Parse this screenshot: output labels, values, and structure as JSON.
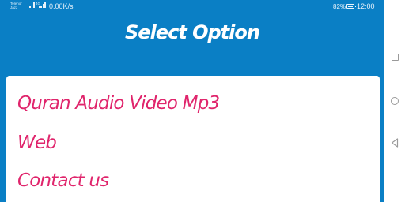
{
  "status_bar": {
    "carrier_line1": "Telenor",
    "carrier_line2": "Jazz",
    "network_tag": "4G",
    "net_speed": "0.00K/s",
    "battery_percent": "82%",
    "time": "12:00"
  },
  "header": {
    "title": "Select Option"
  },
  "menu": {
    "items": [
      {
        "label": "Quran Audio Video Mp3"
      },
      {
        "label": "Web"
      },
      {
        "label": "Contact us"
      }
    ]
  },
  "colors": {
    "header_bg": "#0a7fc5",
    "option_text": "#e0256c",
    "card_bg": "#ffffff"
  },
  "navigation": {
    "icons": [
      "recents-square-icon",
      "home-circle-icon",
      "back-triangle-icon"
    ]
  }
}
